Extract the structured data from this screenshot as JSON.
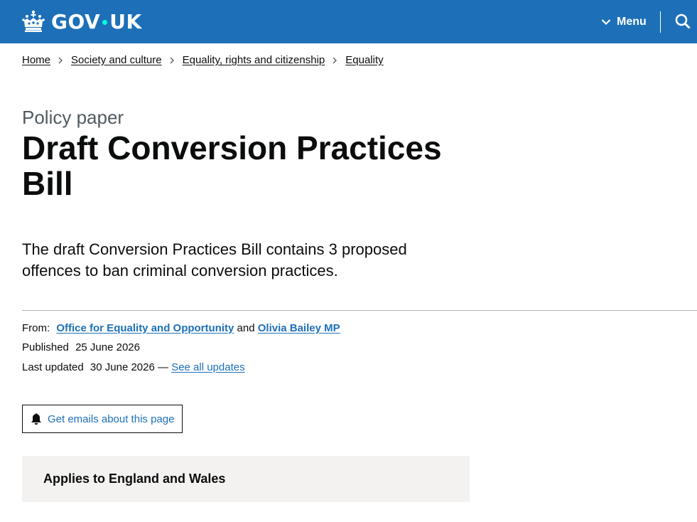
{
  "header": {
    "logo_text_left": "GOV",
    "logo_text_right": "UK",
    "menu_label": "Menu",
    "icons": {
      "logo": "crown-icon",
      "menu": "chevron-down-icon",
      "search": "search-icon"
    },
    "colors": {
      "header_bg": "#1d70b8",
      "logo_dot": "#00ffe0"
    }
  },
  "breadcrumbs": [
    {
      "label": "Home"
    },
    {
      "label": "Society and culture"
    },
    {
      "label": "Equality, rights and citizenship"
    },
    {
      "label": "Equality"
    }
  ],
  "page": {
    "caption": "Policy paper",
    "title": "Draft Conversion Practices Bill",
    "lede": "The draft Conversion Practices Bill contains 3 proposed offences to ban criminal conversion practices."
  },
  "metadata": {
    "from_label": "From:",
    "from_org_1": "Office for Equality and Opportunity",
    "from_and": "and",
    "from_org_2": "Olivia Bailey MP",
    "published_label": "Published",
    "published_date": "25 June 2026",
    "updated_label": "Last updated",
    "updated_date": "30 June 2026 —",
    "see_all_updates": "See all updates",
    "colors": {
      "link": "#1d70b8",
      "text": "#0b0c0c"
    }
  },
  "email_button": {
    "label": "Get emails about this page",
    "icon": "bell-icon"
  },
  "applies_to": {
    "text": "Applies to England and Wales"
  }
}
